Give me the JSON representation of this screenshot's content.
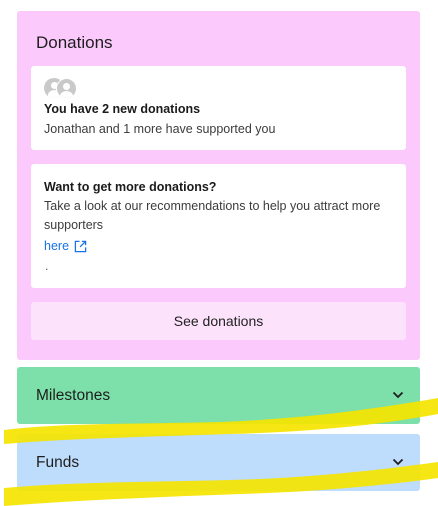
{
  "donations": {
    "title": "Donations",
    "new_donations": {
      "heading": "You have 2 new donations",
      "text": "Jonathan and 1 more have supported you"
    },
    "tips": {
      "heading": "Want to get more donations?",
      "text": "Take a look at our recommendations to help you attract more supporters",
      "link_label": "here",
      "trailing": "."
    },
    "see_button": "See donations"
  },
  "milestones": {
    "title": "Milestones"
  },
  "funds": {
    "title": "Funds"
  },
  "colors": {
    "donations_panel": "#fbc9fb",
    "milestones_panel": "#7ddfa9",
    "funds_panel": "#bedcfb",
    "link": "#1a73e8",
    "highlight": "#f5e400"
  },
  "icons": [
    "avatar-group-icon",
    "external-link-icon",
    "chevron-down-icon"
  ]
}
